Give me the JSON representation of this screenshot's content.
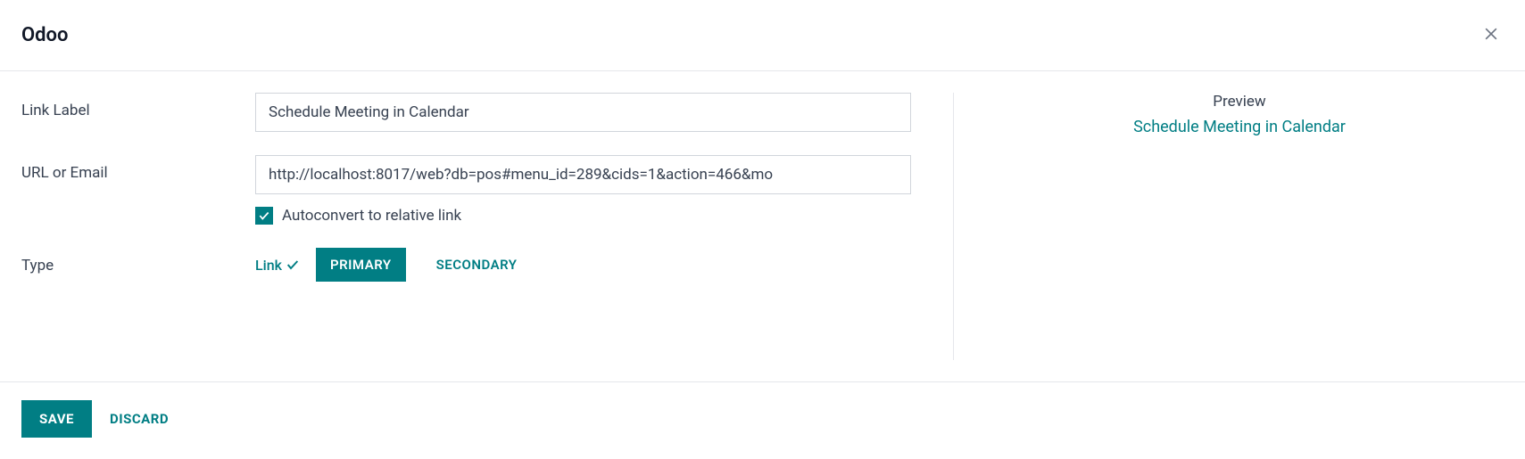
{
  "header": {
    "title": "Odoo"
  },
  "form": {
    "link_label": {
      "label": "Link Label",
      "value": "Schedule Meeting in Calendar"
    },
    "url_or_email": {
      "label": "URL or Email",
      "value": "http://localhost:8017/web?db=pos#menu_id=289&cids=1&action=466&mo"
    },
    "autoconvert": {
      "label": "Autoconvert to relative link",
      "checked": true
    },
    "type": {
      "label": "Type",
      "link_option": "Link",
      "primary_option": "PRIMARY",
      "secondary_option": "SECONDARY"
    }
  },
  "preview": {
    "heading": "Preview",
    "link_text": "Schedule Meeting in Calendar"
  },
  "footer": {
    "save": "SAVE",
    "discard": "DISCARD"
  }
}
